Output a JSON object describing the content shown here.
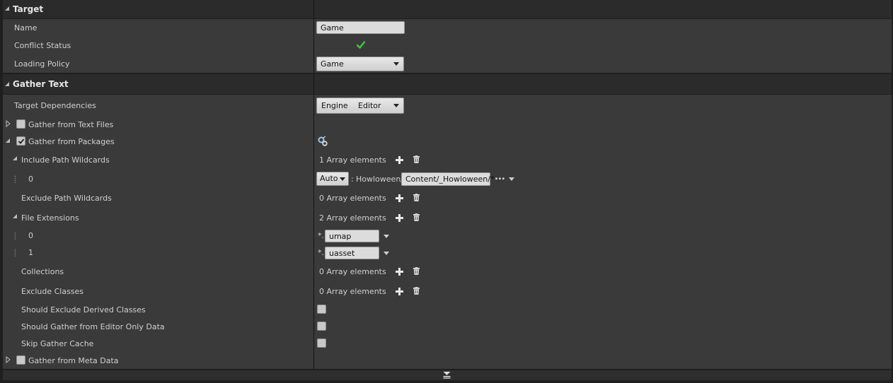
{
  "sections": {
    "target": "Target",
    "gather_text": "Gather Text"
  },
  "fields": {
    "name_label": "Name",
    "name_value": "Game",
    "conflict_label": "Conflict Status",
    "loading_policy_label": "Loading Policy",
    "loading_policy_value": "Game",
    "target_deps_label": "Target Dependencies",
    "target_deps_value_1": "Engine",
    "target_deps_value_2": "Editor",
    "gather_text_files_label": "Gather from Text Files",
    "gather_packages_label": "Gather from Packages",
    "include_wildcards_label": "Include Path Wildcards",
    "include_wildcards_count": "1 Array elements",
    "include_index_0": "0",
    "include_auto": "Auto",
    "include_colon": ":",
    "include_root": "Howloween/",
    "include_path": "Content/_Howloween/*",
    "include_browse": "...",
    "exclude_wildcards_label": "Exclude Path Wildcards",
    "exclude_wildcards_count": "0 Array elements",
    "file_ext_label": "File Extensions",
    "file_ext_count": "2 Array elements",
    "file_ext_index_0": "0",
    "file_ext_index_1": "1",
    "file_ext_prefix": "*.",
    "file_ext_0": "umap",
    "file_ext_1": "uasset",
    "collections_label": "Collections",
    "collections_count": "0 Array elements",
    "exclude_classes_label": "Exclude Classes",
    "exclude_classes_count": "0 Array elements",
    "exclude_derived_label": "Should Exclude Derived Classes",
    "gather_editor_only_label": "Should Gather from Editor Only Data",
    "skip_cache_label": "Skip Gather Cache",
    "gather_meta_label": "Gather from Meta Data"
  },
  "states": {
    "conflict_ok": true,
    "gather_text_files_checked": false,
    "gather_packages_checked": true,
    "exclude_derived_checked": false,
    "gather_editor_only_checked": false,
    "skip_cache_checked": false,
    "gather_meta_checked": false
  },
  "colors": {
    "check_green": "#3ec23e",
    "panel_bg": "#3a3a3a",
    "category_bg": "#2b2b2b"
  }
}
